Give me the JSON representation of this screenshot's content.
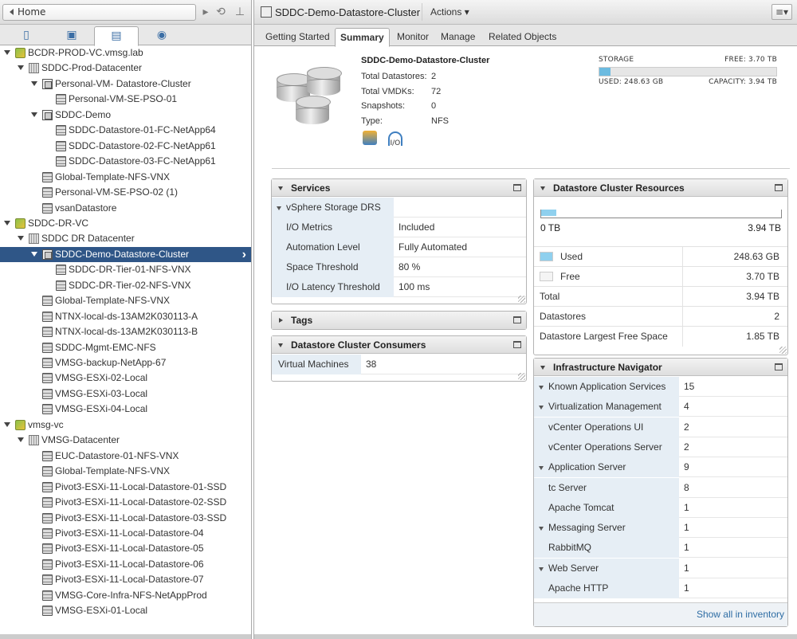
{
  "nav": {
    "home_label": "Home"
  },
  "tree": [
    {
      "label": "BCDR-PROD-VC.vmsg.lab",
      "level": 0,
      "icon": "vcenter",
      "twisty": "open"
    },
    {
      "label": "SDDC-Prod-Datacenter",
      "level": 1,
      "icon": "datacenter",
      "twisty": "open"
    },
    {
      "label": "Personal-VM- Datastore-Cluster",
      "level": 2,
      "icon": "datastore-cluster",
      "twisty": "open"
    },
    {
      "label": "Personal-VM-SE-PSO-01",
      "level": 3,
      "icon": "datastore",
      "twisty": "none"
    },
    {
      "label": "SDDC-Demo",
      "level": 2,
      "icon": "datastore-cluster",
      "twisty": "open"
    },
    {
      "label": "SDDC-Datastore-01-FC-NetApp64",
      "level": 3,
      "icon": "datastore",
      "twisty": "none"
    },
    {
      "label": "SDDC-Datastore-02-FC-NetApp61",
      "level": 3,
      "icon": "datastore",
      "twisty": "none"
    },
    {
      "label": "SDDC-Datastore-03-FC-NetApp61",
      "level": 3,
      "icon": "datastore",
      "twisty": "none"
    },
    {
      "label": "Global-Template-NFS-VNX",
      "level": 2,
      "icon": "datastore",
      "twisty": "none"
    },
    {
      "label": "Personal-VM-SE-PSO-02 (1)",
      "level": 2,
      "icon": "datastore",
      "twisty": "none"
    },
    {
      "label": "vsanDatastore",
      "level": 2,
      "icon": "datastore",
      "twisty": "none"
    },
    {
      "label": "SDDC-DR-VC",
      "level": 0,
      "icon": "vcenter",
      "twisty": "open"
    },
    {
      "label": "SDDC DR Datacenter",
      "level": 1,
      "icon": "datacenter",
      "twisty": "open"
    },
    {
      "label": "SDDC-Demo-Datastore-Cluster",
      "level": 2,
      "icon": "datastore-cluster",
      "twisty": "open",
      "selected": true
    },
    {
      "label": "SDDC-DR-Tier-01-NFS-VNX",
      "level": 3,
      "icon": "datastore",
      "twisty": "none"
    },
    {
      "label": "SDDC-DR-Tier-02-NFS-VNX",
      "level": 3,
      "icon": "datastore",
      "twisty": "none"
    },
    {
      "label": "Global-Template-NFS-VNX",
      "level": 2,
      "icon": "datastore",
      "twisty": "none"
    },
    {
      "label": "NTNX-local-ds-13AM2K030113-A",
      "level": 2,
      "icon": "datastore",
      "twisty": "none"
    },
    {
      "label": "NTNX-local-ds-13AM2K030113-B",
      "level": 2,
      "icon": "datastore",
      "twisty": "none"
    },
    {
      "label": "SDDC-Mgmt-EMC-NFS",
      "level": 2,
      "icon": "datastore",
      "twisty": "none"
    },
    {
      "label": "VMSG-backup-NetApp-67",
      "level": 2,
      "icon": "datastore",
      "twisty": "none"
    },
    {
      "label": "VMSG-ESXi-02-Local",
      "level": 2,
      "icon": "datastore",
      "twisty": "none"
    },
    {
      "label": "VMSG-ESXi-03-Local",
      "level": 2,
      "icon": "datastore",
      "twisty": "none"
    },
    {
      "label": "VMSG-ESXi-04-Local",
      "level": 2,
      "icon": "datastore",
      "twisty": "none"
    },
    {
      "label": "vmsg-vc",
      "level": 0,
      "icon": "vcenter",
      "twisty": "open"
    },
    {
      "label": "VMSG-Datacenter",
      "level": 1,
      "icon": "datacenter",
      "twisty": "open"
    },
    {
      "label": "EUC-Datastore-01-NFS-VNX",
      "level": 2,
      "icon": "datastore",
      "twisty": "none"
    },
    {
      "label": "Global-Template-NFS-VNX",
      "level": 2,
      "icon": "datastore",
      "twisty": "none"
    },
    {
      "label": "Pivot3-ESXi-11-Local-Datastore-01-SSD",
      "level": 2,
      "icon": "datastore",
      "twisty": "none"
    },
    {
      "label": "Pivot3-ESXi-11-Local-Datastore-02-SSD",
      "level": 2,
      "icon": "datastore",
      "twisty": "none"
    },
    {
      "label": "Pivot3-ESXi-11-Local-Datastore-03-SSD",
      "level": 2,
      "icon": "datastore",
      "twisty": "none"
    },
    {
      "label": "Pivot3-ESXi-11-Local-Datastore-04",
      "level": 2,
      "icon": "datastore",
      "twisty": "none"
    },
    {
      "label": "Pivot3-ESXi-11-Local-Datastore-05",
      "level": 2,
      "icon": "datastore",
      "twisty": "none"
    },
    {
      "label": "Pivot3-ESXi-11-Local-Datastore-06",
      "level": 2,
      "icon": "datastore",
      "twisty": "none"
    },
    {
      "label": "Pivot3-ESXi-11-Local-Datastore-07",
      "level": 2,
      "icon": "datastore",
      "twisty": "none"
    },
    {
      "label": "VMSG-Core-Infra-NFS-NetAppProd",
      "level": 2,
      "icon": "datastore",
      "twisty": "none"
    },
    {
      "label": "VMSG-ESXi-01-Local",
      "level": 2,
      "icon": "datastore",
      "twisty": "none"
    }
  ],
  "header": {
    "title": "SDDC-Demo-Datastore-Cluster",
    "actions_label": "Actions"
  },
  "tabs": [
    "Getting Started",
    "Summary",
    "Monitor",
    "Manage",
    "Related Objects"
  ],
  "active_tab": "Summary",
  "summary": {
    "name": "SDDC-Demo-Datastore-Cluster",
    "rows": [
      {
        "label": "Total Datastores:",
        "value": "2"
      },
      {
        "label": "Total VMDKs:",
        "value": "72"
      },
      {
        "label": "Snapshots:",
        "value": "0"
      },
      {
        "label": "Type:",
        "value": "NFS"
      }
    ],
    "io_label": "I/O",
    "storage": {
      "label": "STORAGE",
      "free": "FREE: 3.70 TB",
      "used": "USED: 248.63 GB",
      "capacity": "CAPACITY: 3.94 TB",
      "used_fraction": 0.062
    }
  },
  "services": {
    "title": "Services",
    "group": "vSphere Storage DRS",
    "rows": [
      {
        "label": "I/O Metrics",
        "value": "Included"
      },
      {
        "label": "Automation Level",
        "value": "Fully Automated"
      },
      {
        "label": "Space Threshold",
        "value": "80 %"
      },
      {
        "label": "I/O Latency Threshold",
        "value": "100 ms"
      }
    ]
  },
  "tags": {
    "title": "Tags"
  },
  "consumers": {
    "title": "Datastore Cluster Consumers",
    "rows": [
      {
        "label": "Virtual Machines",
        "value": "38"
      }
    ]
  },
  "resources": {
    "title": "Datastore Cluster Resources",
    "bar_min": "0 TB",
    "bar_max": "3.94 TB",
    "used_fraction": 0.062,
    "rows": [
      {
        "label": "Used",
        "value": "248.63 GB",
        "swatch": "#8fd0ee"
      },
      {
        "label": "Free",
        "value": "3.70 TB",
        "swatch": "#f4f4f4"
      },
      {
        "label": "Total",
        "value": "3.94 TB"
      },
      {
        "label": "Datastores",
        "value": "2"
      },
      {
        "label": "Datastore Largest Free Space",
        "value": "1.85 TB"
      }
    ]
  },
  "infra": {
    "title": "Infrastructure Navigator",
    "rows": [
      {
        "label": "Known Application Services",
        "value": "15",
        "group": true
      },
      {
        "label": "Virtualization Management",
        "value": "4",
        "group": true
      },
      {
        "label": "vCenter Operations UI",
        "value": "2",
        "group": false
      },
      {
        "label": "vCenter Operations Server",
        "value": "2",
        "group": false
      },
      {
        "label": "Application Server",
        "value": "9",
        "group": true
      },
      {
        "label": "tc Server",
        "value": "8",
        "group": false
      },
      {
        "label": "Apache Tomcat",
        "value": "1",
        "group": false
      },
      {
        "label": "Messaging Server",
        "value": "1",
        "group": true
      },
      {
        "label": "RabbitMQ",
        "value": "1",
        "group": false
      },
      {
        "label": "Web Server",
        "value": "1",
        "group": true
      },
      {
        "label": "Apache HTTP",
        "value": "1",
        "group": false
      }
    ],
    "show_all": "Show all in inventory"
  },
  "colors": {
    "selection": "#2f5687",
    "accent": "#6cbbe0",
    "key_bg": "#e6eef5"
  }
}
